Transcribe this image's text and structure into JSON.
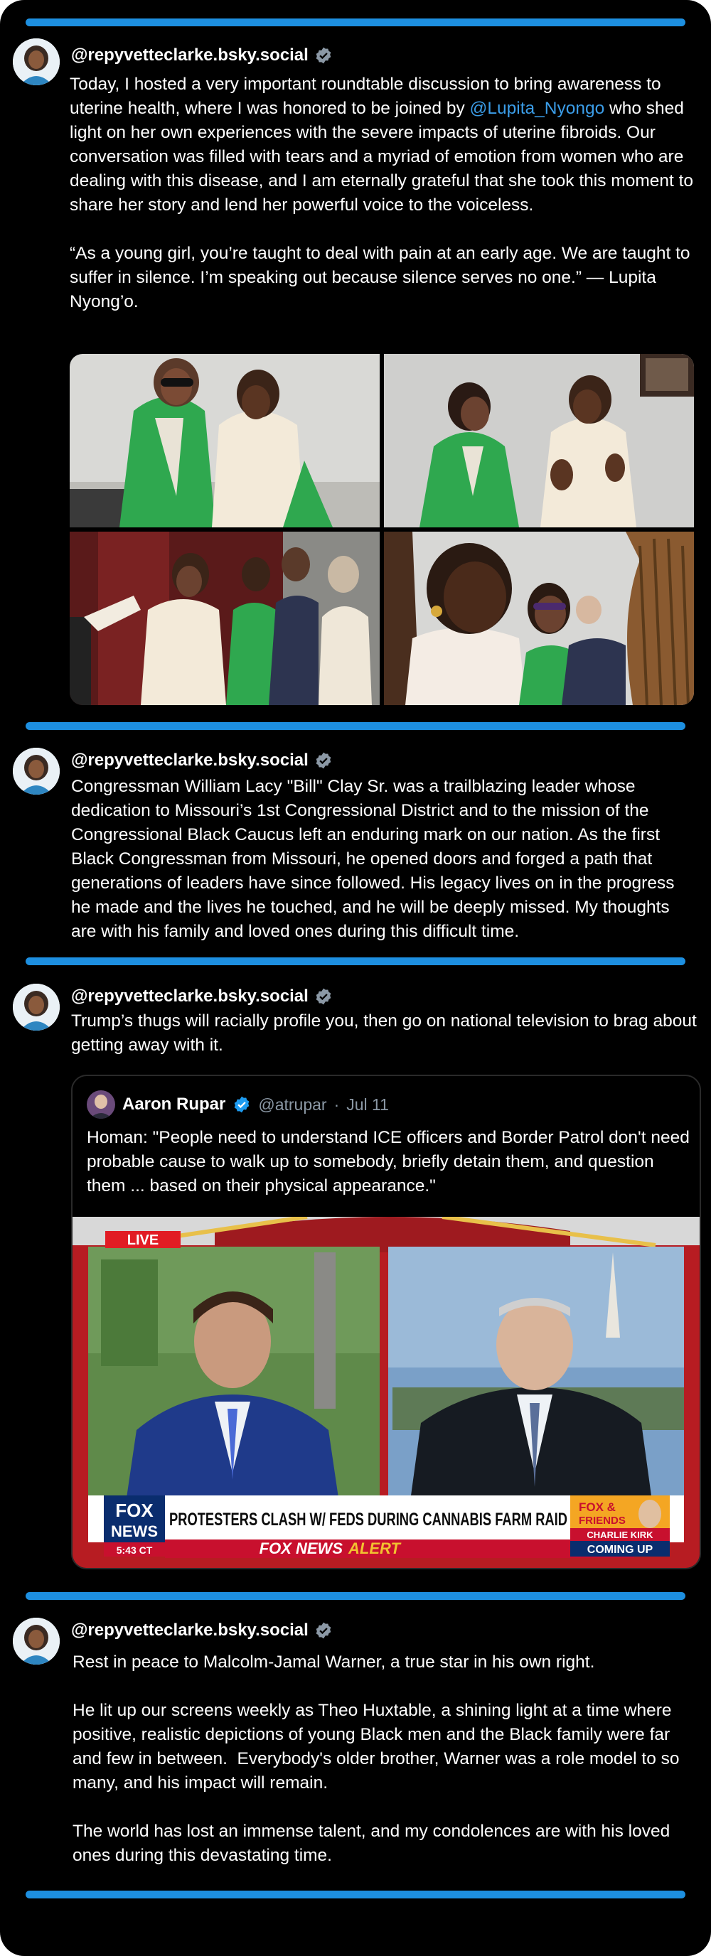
{
  "colors": {
    "accent_bar": "#1d8fe0",
    "mention": "#3b9de8",
    "verified": "#1d9bf0",
    "fox_red": "#c8102e"
  },
  "posts": [
    {
      "handle": "@repyvetteclarke.bsky.social",
      "avatar_icon": "profile-photo",
      "verified_icon": "verified-badge-icon",
      "text_part1": "Today, I hosted a very important roundtable discussion to bring awareness to uterine health, where I was honored to be joined by ",
      "mention": "@Lupita_Nyongo",
      "text_part2": " who shed light on her own experiences with the severe impacts of uterine fibroids. Our conversation was filled with tears and a myriad of emotion from women who are dealing with this disease, and I am eternally grateful that she took this moment to share her story and lend her powerful voice to the voiceless.\n\n“As a young girl, you’re taught to deal with pain at an early age. We are taught to suffer in silence. I’m speaking out because silence serves no one.” — Lupita Nyong’o."
    },
    {
      "handle": "@repyvetteclarke.bsky.social",
      "avatar_icon": "profile-photo",
      "verified_icon": "verified-badge-icon",
      "text": "Congressman William Lacy \"Bill\" Clay Sr. was a trailblazing leader whose dedication to Missouri’s 1st Congressional District and to the mission of the Congressional Black Caucus left an enduring mark on our nation. As the first Black Congressman from Missouri, he opened doors and forged a path that generations of leaders have since followed. His legacy lives on in the progress he made and the lives he touched, and he will be deeply missed. My thoughts are with his family and loved ones during this difficult time."
    },
    {
      "handle": "@repyvetteclarke.bsky.social",
      "avatar_icon": "profile-photo",
      "verified_icon": "verified-badge-icon",
      "text": "Trump’s thugs will racially profile you, then go on national television to brag about getting away with it.",
      "quote": {
        "name": "Aaron Rupar",
        "handle": "@atrupar",
        "separator": "·",
        "date": "Jul 11",
        "text": "Homan: \"People need to understand ICE officers and Border Patrol don't need probable cause to walk up to somebody, briefly detain them, and question them ... based on their physical appearance.\"",
        "tv": {
          "live": "LIVE",
          "network_top": "FOX",
          "network_bottom": "NEWS",
          "time": "5:43 CT",
          "headline": "PROTESTERS CLASH W/ FEDS DURING CANNABIS FARM RAID",
          "alert_brand": "FOX NEWS",
          "alert_word": "ALERT",
          "promo_top": "FOX &",
          "promo_mid": "FRIENDS",
          "promo_name": "CHARLIE KIRK",
          "promo_bottom": "COMING UP"
        }
      }
    },
    {
      "handle": "@repyvetteclarke.bsky.social",
      "avatar_icon": "profile-photo",
      "verified_icon": "verified-badge-icon",
      "text": "Rest in peace to Malcolm-Jamal Warner, a true star in his own right.\n\nHe lit up our screens weekly as Theo Huxtable, a shining light at a time where positive, realistic depictions of young Black men and the Black family were far and few in between.  Everybody's older brother, Warner was a role model to so many, and his impact will remain.\n\nThe world has lost an immense talent, and my condolences are with his loved ones during this devastating time."
    }
  ]
}
